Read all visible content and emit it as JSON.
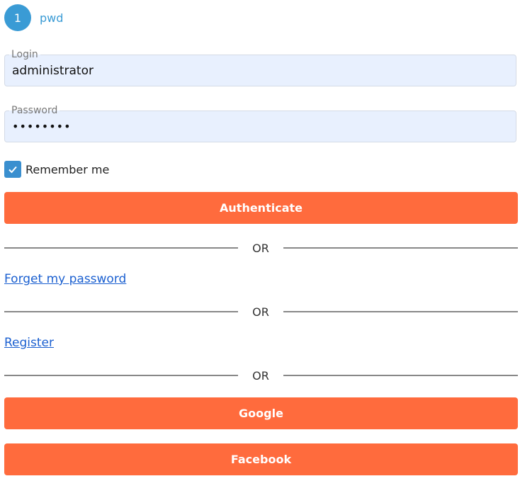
{
  "colors": {
    "accent": "#ff6b3d",
    "step_blue": "#3a9bd5",
    "input_bg": "#e8f0fe",
    "link_blue": "#1a5fd0",
    "checkbox_blue": "#3a8fcf"
  },
  "step": {
    "number": "1",
    "label": "pwd"
  },
  "login": {
    "label": "Login",
    "value": "administrator"
  },
  "password": {
    "label": "Password",
    "value": "password"
  },
  "remember": {
    "label": "Remember me",
    "checked": true
  },
  "buttons": {
    "authenticate": "Authenticate",
    "google": "Google",
    "facebook": "Facebook"
  },
  "divider_text": "OR",
  "links": {
    "forgot": "Forget my password",
    "register": "Register"
  },
  "icons": {
    "checkbox": "check-icon"
  }
}
